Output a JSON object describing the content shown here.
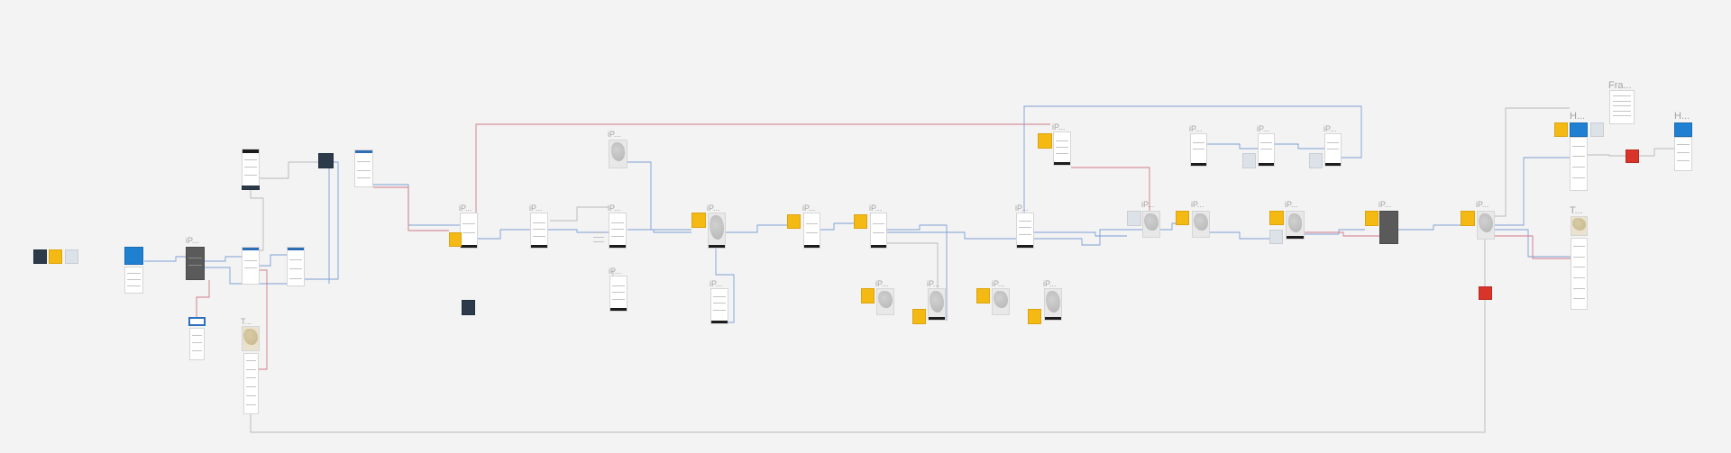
{
  "canvas": {
    "background": "#f3f3f3",
    "connector_colors": {
      "blue": "#7e9fd6",
      "red": "#d07a86",
      "grey": "#b9b9b9"
    }
  },
  "labels": {
    "ip": "iP...",
    "t": "T...",
    "fra": "Fra...",
    "h": "H..."
  }
}
